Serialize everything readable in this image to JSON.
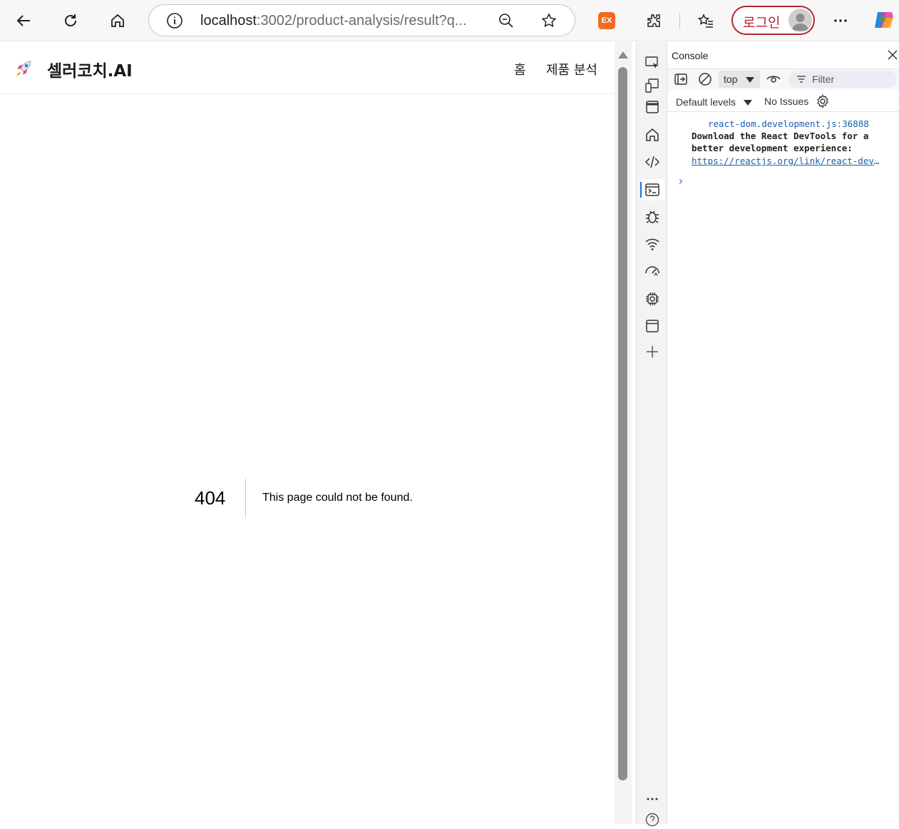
{
  "browser": {
    "url_host": "localhost",
    "url_rest": ":3002/product-analysis/result?q...",
    "extension_badge": "EX",
    "login_label": "로그인"
  },
  "site": {
    "brand": "셀러코치.AI",
    "nav": [
      "홈",
      "제품 분석"
    ]
  },
  "not_found": {
    "code": "404",
    "message": "This page could not be found."
  },
  "devtools": {
    "title": "Console",
    "context": "top",
    "filter_placeholder": "Filter",
    "levels": "Default levels",
    "issues": "No Issues",
    "log": {
      "source": "react-dom.development.js:36888",
      "line1": "Download the React DevTools for a",
      "line2": "better development experience:",
      "link": "https://reactjs.org/link/react-devtools"
    },
    "prompt": "›"
  },
  "colors": {
    "login_accent": "#b3262d",
    "link_blue": "#1a5eb0",
    "active_blue": "#1a73e8"
  }
}
